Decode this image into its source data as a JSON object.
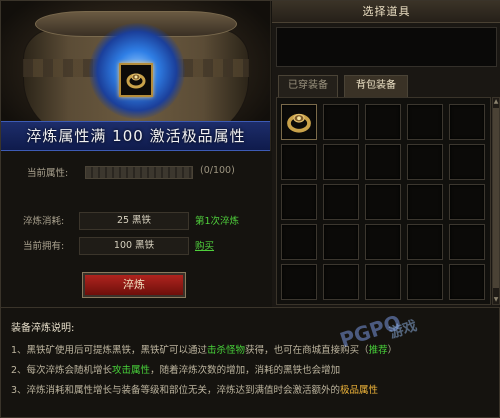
{
  "banner": "淬炼属性满 100 激活极品属性",
  "current_attr": {
    "label": "当前属性:",
    "progress_text": "(0/100)",
    "progress": 0
  },
  "cost": {
    "label": "淬炼消耗:",
    "value": "25 黑铁",
    "note": "第1次淬炼"
  },
  "owned": {
    "label": "当前拥有:",
    "value": "100 黑铁",
    "buy_link": "购买"
  },
  "refine_button": "淬炼",
  "right_panel": {
    "title": "选择道具",
    "tabs": [
      "已穿装备",
      "背包装备"
    ],
    "active_tab": 1
  },
  "notes": {
    "heading": "装备淬炼说明:",
    "line1_a": "1、黑铁矿使用后可提炼黑铁，黑铁矿可以通过",
    "line1_link": "击杀怪物",
    "line1_b": "获得，也可在商城直接购买（",
    "line1_link2": "推荐",
    "line1_c": "）",
    "line2_a": "2、每次淬炼会随机增长",
    "line2_link": "攻击属性",
    "line2_b": "，随着淬炼次数的增加，消耗的黑铁也会增加",
    "line3_a": "3、淬炼消耗和属性增长与装备等级和部位无关，淬炼达到满值时会激活额外的",
    "line3_hl": "极品属性"
  },
  "watermark": {
    "a": "PGPO",
    "b": "游戏"
  },
  "icons": [
    "ring-icon",
    "scroll-up-icon",
    "scroll-down-icon"
  ],
  "colors": {
    "accent_green": "#4fd03c",
    "accent_orange": "#f0b53a",
    "button_red": "#b0241e",
    "banner_blue": "#1d2d6a"
  }
}
